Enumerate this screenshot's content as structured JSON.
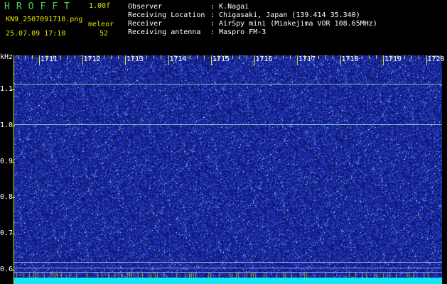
{
  "header": {
    "title": "HROFFT",
    "version": "1.00f",
    "filename": "KN9_2507091710.png",
    "timestamp": "25.07.09 17:10",
    "mode": "meleor",
    "count": "52",
    "fields": [
      {
        "label": "Observer",
        "value": ": K.Nagai"
      },
      {
        "label": "Receiving Location",
        "value": ": Chigasaki, Japan (139.414 35.340)"
      },
      {
        "label": "Receiver",
        "value": ": AirSpy mini (Miakejima VOR 108.65MHz)"
      },
      {
        "label": "Receiving antenna",
        "value": ": Maspro FM-3"
      }
    ]
  },
  "spectrogram": {
    "y_unit": "kHz",
    "x_ticks": [
      "1711",
      "1712",
      "1713",
      "1714",
      "1715",
      "1716",
      "1717",
      "1718",
      "1719",
      "1720"
    ],
    "y_ticks": [
      "1.1",
      "1.0",
      "0.9",
      "0.8",
      "0.7",
      "0.6"
    ],
    "colors": {
      "background": "#15157a",
      "noise": "#3a6bff",
      "line": "#9fe6c8",
      "axis_label": "#ffffff",
      "tick": "#e6e600",
      "baseline": "#14e6f5"
    }
  }
}
